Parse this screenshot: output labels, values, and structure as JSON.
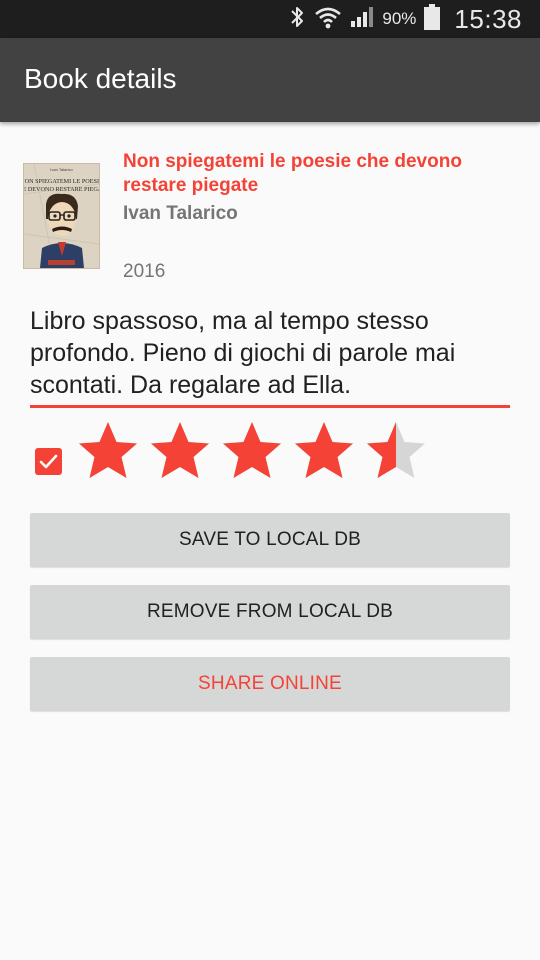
{
  "status_bar": {
    "battery_percent": "90%",
    "time": "15:38"
  },
  "app_bar": {
    "title": "Book details"
  },
  "book": {
    "cover_text": "NON SPIEGATEMI LE POESIE CHE DEVONO RESTARE PIEGATE",
    "title": "Non spiegatemi le poesie che devono restare piegate",
    "author": "Ivan Talarico",
    "year": "2016"
  },
  "review": {
    "text": "Libro spassoso, ma al tempo stesso profondo. Pieno di giochi di parole mai scontati. Da regalare ad Ella."
  },
  "read_checkbox": {
    "checked": true
  },
  "rating": {
    "value": 4.5,
    "max": 5,
    "filled_color": "#f44336",
    "empty_color": "#d6d6d6"
  },
  "buttons": {
    "save": "SAVE TO LOCAL DB",
    "remove": "REMOVE FROM LOCAL DB",
    "share": "SHARE ONLINE"
  },
  "colors": {
    "accent": "#f44336",
    "app_bar": "#424242",
    "status_bar": "#1e1e1e",
    "button_bg": "#d6d7d7"
  },
  "icons": [
    "bluetooth-icon",
    "wifi-icon",
    "signal-icon",
    "battery-icon",
    "check-icon",
    "star-icon"
  ]
}
